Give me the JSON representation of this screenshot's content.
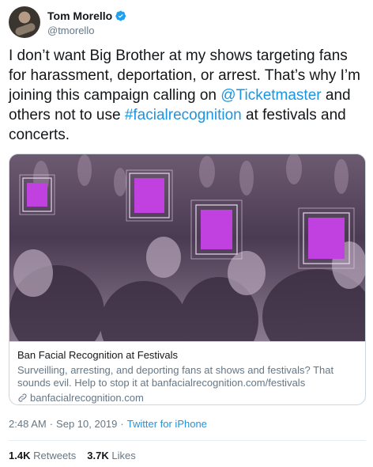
{
  "author": {
    "display_name": "Tom Morello",
    "handle": "@tmorello",
    "verified": true,
    "verified_color": "#1da1f2"
  },
  "tweet": {
    "text_1": "I don’t want Big Brother at my shows targeting fans for harassment, deportation, or arrest. That’s why I’m joining this campaign calling on ",
    "mention": "@Ticketmaster",
    "text_2": " and others not to use ",
    "hashtag": "#facialrecognition",
    "text_3": " at festivals and concerts."
  },
  "card": {
    "image_icon": "concert-crowd-image",
    "title": "Ban Facial Recognition at Festivals",
    "description": "Surveilling, arresting, and deporting fans at shows and festivals? That sounds evil. Help to stop it at banfacialrecognition.com/festivals",
    "domain": "banfacialrecognition.com"
  },
  "meta": {
    "time": "2:48 AM",
    "separator": "·",
    "date": "Sep 10, 2019",
    "source": "Twitter for iPhone"
  },
  "stats": {
    "retweets_count": "1.4K",
    "retweets_label": "Retweets",
    "likes_count": "3.7K",
    "likes_label": "Likes"
  },
  "colors": {
    "link": "#1b95e0",
    "text": "#14171a",
    "muted": "#657786",
    "face_highlight": "#c040e0"
  }
}
